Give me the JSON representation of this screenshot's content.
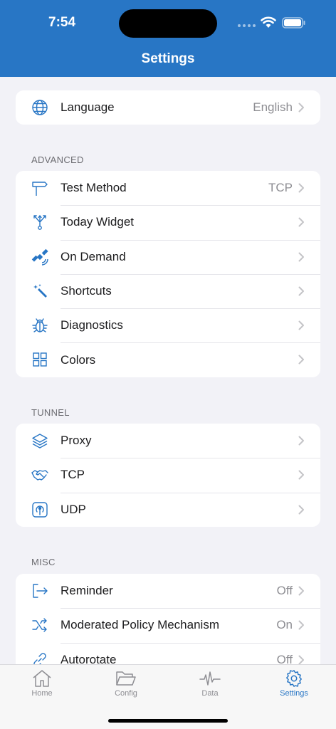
{
  "status": {
    "time": "7:54"
  },
  "header": {
    "title": "Settings"
  },
  "general": {
    "items": [
      {
        "label": "Language",
        "value": "English",
        "icon": "globe-icon"
      }
    ]
  },
  "advanced": {
    "title": "ADVANCED",
    "items": [
      {
        "label": "Test Method",
        "value": "TCP",
        "icon": "signpost-icon"
      },
      {
        "label": "Today Widget",
        "value": "",
        "icon": "fork-arrows-icon"
      },
      {
        "label": "On Demand",
        "value": "",
        "icon": "satellite-icon"
      },
      {
        "label": "Shortcuts",
        "value": "",
        "icon": "magic-wand-icon"
      },
      {
        "label": "Diagnostics",
        "value": "",
        "icon": "bug-icon"
      },
      {
        "label": "Colors",
        "value": "",
        "icon": "grid-icon"
      }
    ]
  },
  "tunnel": {
    "title": "TUNNEL",
    "items": [
      {
        "label": "Proxy",
        "value": "",
        "icon": "layers-icon"
      },
      {
        "label": "TCP",
        "value": "",
        "icon": "handshake-icon"
      },
      {
        "label": "UDP",
        "value": "",
        "icon": "antenna-icon"
      }
    ]
  },
  "misc": {
    "title": "MISC",
    "items": [
      {
        "label": "Reminder",
        "value": "Off",
        "icon": "sign-out-icon"
      },
      {
        "label": "Moderated Policy Mechanism",
        "value": "On",
        "icon": "shuffle-icon"
      },
      {
        "label": "Autorotate",
        "value": "Off",
        "icon": "link-icon"
      }
    ]
  },
  "tabbar": {
    "tabs": [
      {
        "label": "Home",
        "icon": "house-icon",
        "active": false
      },
      {
        "label": "Config",
        "icon": "folder-icon",
        "active": false
      },
      {
        "label": "Data",
        "icon": "waveform-icon",
        "active": false
      },
      {
        "label": "Settings",
        "icon": "gear-icon",
        "active": true
      }
    ]
  },
  "colors": {
    "accent": "#2876c5",
    "background": "#f2f2f7",
    "secondary_text": "#8e8e93"
  }
}
